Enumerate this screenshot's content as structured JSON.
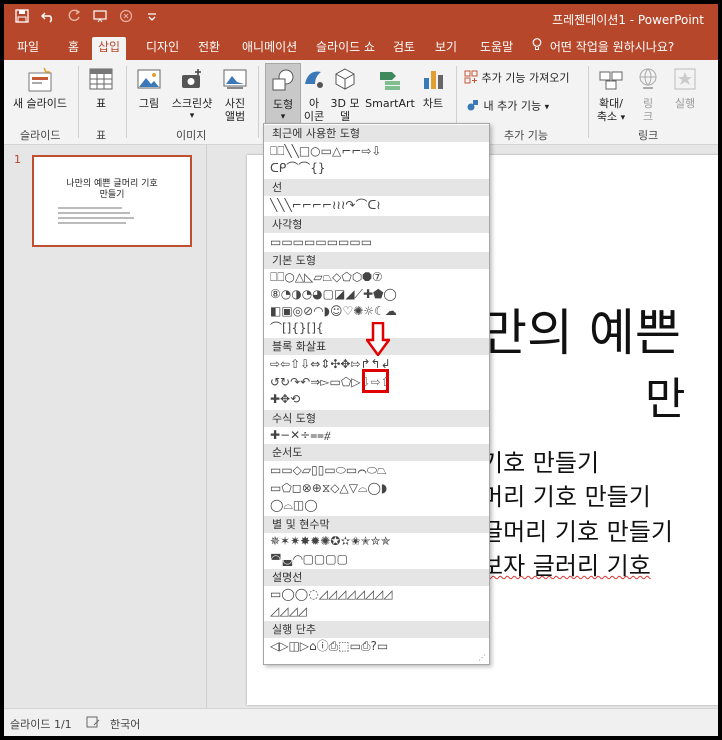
{
  "titlebar": {
    "title": "프레젠테이션1 - PowerPoint",
    "qat": [
      "save-icon",
      "undo-icon",
      "redo-icon",
      "start-from-beginning-icon",
      "touch-mode-icon",
      "customize-qat-icon"
    ]
  },
  "tabs": [
    "파일",
    "홈",
    "삽입",
    "디자인",
    "전환",
    "애니메이션",
    "슬라이드 쇼",
    "검토",
    "보기",
    "도움말"
  ],
  "active_tab": "삽입",
  "tell_me": "어떤 작업을 원하시나요?",
  "ribbon": {
    "new_slide": "새 슬라이드",
    "table": "표",
    "picture": "그림",
    "screenshot": "스크린샷",
    "photo_album_line1": "사진",
    "photo_album_line2": "앨범",
    "shapes": "도형",
    "icons_line1": "아",
    "icons_line2": "이콘",
    "model3d_line1": "3D 모",
    "model3d_line2": "델",
    "smartart": "SmartArt",
    "chart": "차트",
    "get_addins": "추가 기능 가져오기",
    "my_addins": "내 추가 기능",
    "zoom_line1": "확대/",
    "zoom_line2": "축소",
    "link_line1": "링",
    "link_line2": "크",
    "action": "실행",
    "groups": {
      "slides": "슬라이드",
      "tables": "표",
      "images": "이미지",
      "addins": "추가 기능",
      "links": "링크"
    }
  },
  "thumbnail": {
    "number": "1",
    "title_line1": "나만의 예쁜 글머리 기호",
    "title_line2": "만들기"
  },
  "slide": {
    "title_line1": "만의 예쁜",
    "title_line2": "만",
    "bullets": [
      "기호 만들기",
      "머리 기호 만들기",
      "글머리 기호 만들기",
      "보자 글러리 기호"
    ]
  },
  "gallery": {
    "categories": [
      "최근에 사용한 도형",
      "선",
      "사각형",
      "기본 도형",
      "블록 화살표",
      "수식 도형",
      "순서도",
      "별 및 현수막",
      "설명선",
      "실행 단추"
    ],
    "recent_rows": [
      "⎕⎕╲╲□○▭△⌐⌐⇨⇩",
      "ᑕᑭ⌒⌒{}"
    ],
    "lines_rows": [
      "╲╲╲⌐⌐⌐⌐≀≀≀↷⌒ᑕ≀"
    ],
    "rect_rows": [
      "▭▭▭▭▭▭▭▭▭"
    ],
    "basic_rows": [
      "⎕⎕○△◺▱⏢◇⬠⬡⯃⑦",
      "⑧◔◑◔◕▢◪◢⟋✚⬟◯",
      "◧▣◎⊘◠◗☺♡✺☼☾☁",
      "⌒[]{}[]{"
    ],
    "block_rows": [
      "⇨⇦⇧⇩⇔⇕✣✥⇰↱↰↲",
      "↺↻↷↶⇒▻▭⬠▷⇩⇨⇧",
      "✚✥⟲"
    ],
    "equation_rows": [
      "✚−✕÷⩵⧣"
    ],
    "flowchart_rows": [
      "▭▭◇▱▯▯▭⬭▭⌒⬭⏢",
      "▭⬠◻⊗⊕⧖◇△▽⌓◯◗",
      "◯⌓◫◯"
    ],
    "stars_rows": [
      "✵✶✷✸✹✺✪✫✬✭✮✯",
      "◚◛◜◝▢▢▢▢"
    ],
    "callout_rows": [
      "▭◯◯◌◿◿◿◿◿◿◿◿",
      "◿◿◿◿"
    ],
    "action_rows": [
      "◁▷◫▷⌂ⓘ⎙⬚▭⎙?▭"
    ]
  },
  "status": {
    "slide_count": "슬라이드 1/1",
    "language": "한국어"
  },
  "colors": {
    "accent": "#b7472a",
    "annotation": "#e00000"
  }
}
